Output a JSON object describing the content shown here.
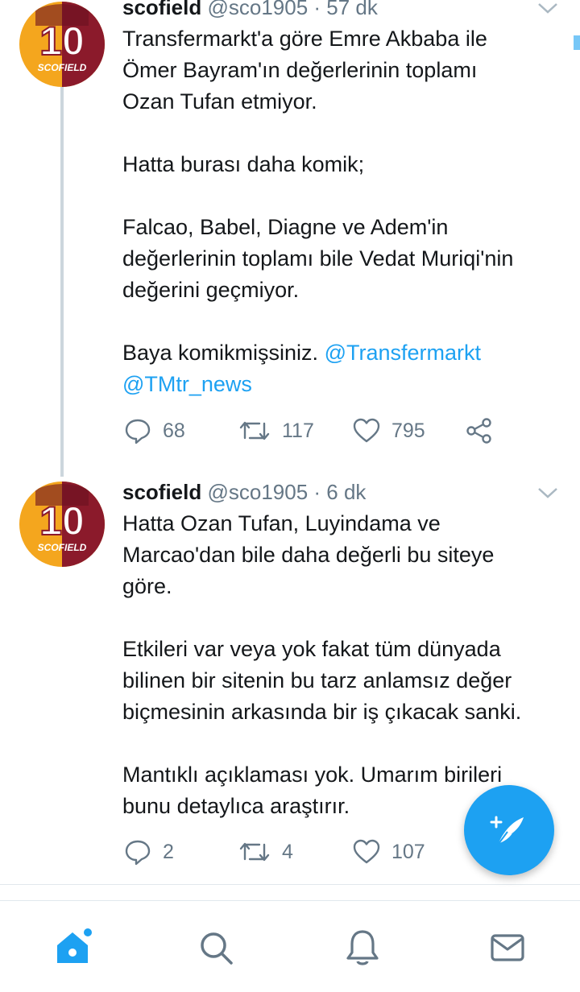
{
  "colors": {
    "accent": "#1da1f2",
    "muted": "#657786",
    "text": "#14171a"
  },
  "tweets": [
    {
      "name": "scofield",
      "meta": "@sco1905 · 57 dk",
      "avatar_text": "SCOFIELD",
      "avatar_number": "10",
      "paragraphs": [
        "Transfermarkt'a göre Emre Akbaba ile",
        "Ömer Bayram'ın değerlerinin toplamı",
        "Ozan Tufan etmiyor.",
        "",
        "Hatta burası daha komik;",
        "",
        "Falcao, Babel, Diagne ve Adem'in",
        "değerlerinin toplamı bile Vedat Muriqi'nin",
        "değerini geçmiyor.",
        "",
        "Baya komikmişsiniz."
      ],
      "mention1": "@Transfermarkt",
      "mention2": "@TMtr_news",
      "replies": "68",
      "retweets": "117",
      "likes": "795"
    },
    {
      "name": "scofield",
      "meta": "@sco1905 · 6 dk",
      "avatar_text": "SCOFIELD",
      "avatar_number": "10",
      "paragraphs": [
        "Hatta Ozan Tufan, Luyindama ve",
        "Marcao'dan bile daha değerli bu siteye",
        "göre.",
        "",
        "Etkileri var veya yok fakat tüm dünyada",
        "bilinen bir sitenin bu tarz anlamsız değer",
        "biçmesinin arkasında bir iş çıkacak sanki.",
        "",
        "Mantıklı açıklaması yok. Umarım birileri",
        "bunu detaylıca araştırır."
      ],
      "replies": "2",
      "retweets": "4",
      "likes": "107"
    }
  ],
  "nav": {
    "items": [
      "home-icon",
      "search-icon",
      "notifications-icon",
      "messages-icon"
    ],
    "compose_icon": "compose-tweet-icon"
  }
}
